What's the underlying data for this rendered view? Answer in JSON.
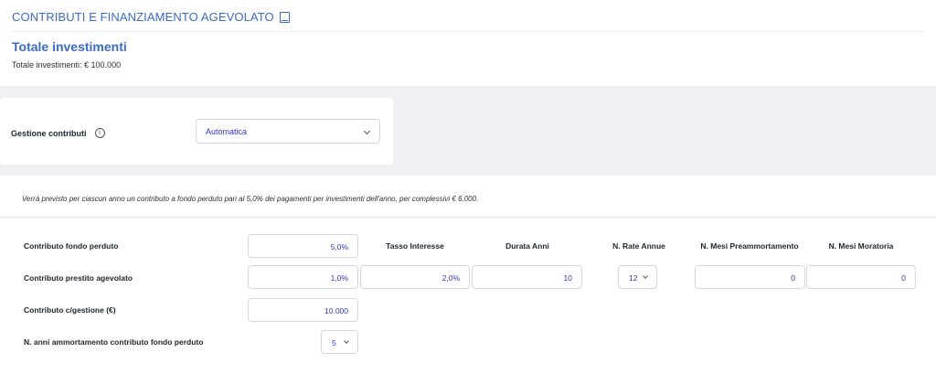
{
  "header": {
    "title": "CONTRIBUTI E FINANZIAMENTO AGEVOLATO",
    "section_title": "Totale investimenti",
    "section_subtitle": "Totale investimenti: € 100.000"
  },
  "gestione": {
    "label": "Gestione contributi",
    "info_glyph": "i",
    "selected": "Automatica"
  },
  "note": "Verrà previsto per ciascun anno un contributo a fondo perduto pari al 5,0% dei pagamenti per investimenti dell'anno, per complessivi € 6.000.",
  "table": {
    "columns": {
      "tasso": "Tasso Interesse",
      "durata": "Durata Anni",
      "rate": "N. Rate Annue",
      "preamm": "N. Mesi Preammortamento",
      "moratoria": "N. Mesi Moratoria"
    },
    "rows": {
      "fondo_perduto": {
        "label": "Contributo fondo perduto",
        "value": "5,0%"
      },
      "prestito": {
        "label": "Contributo prestito agevolato",
        "value": "1,0%",
        "tasso": "2,0%",
        "durata": "10",
        "rate": "12",
        "preamm": "0",
        "moratoria": "0"
      },
      "gestione": {
        "label": "Contributo c/gestione (€)",
        "value": "10.000"
      },
      "ammortamento": {
        "label": "N. anni ammortamento contributo fondo perduto",
        "value": "5"
      }
    }
  },
  "icons": [
    "book-icon",
    "info-icon",
    "chevron-down-icon"
  ],
  "colors": {
    "accent": "#3b6bc5",
    "value_text": "#2a36c8",
    "page_bg": "#eef0f3"
  }
}
